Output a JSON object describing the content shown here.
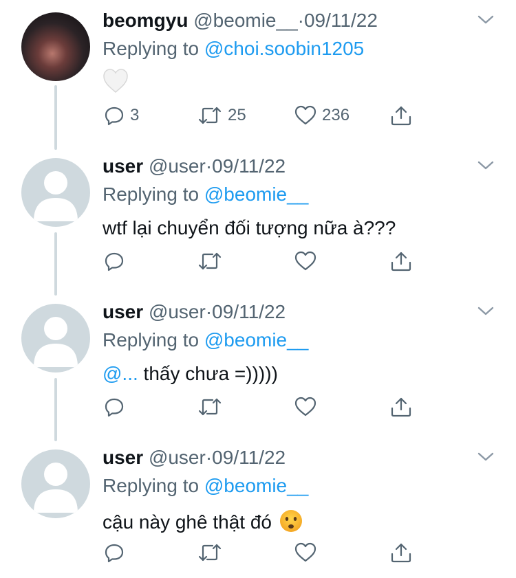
{
  "tweets": [
    {
      "name": "beomgyu",
      "handle": "@beomie__",
      "sep": "·",
      "date": "09/11/22",
      "replying_prefix": "Replying to",
      "replying_to": "@choi.soobin1205",
      "body_emoji": "white-heart",
      "reply_count": "3",
      "retweet_count": "25",
      "like_count": "236"
    },
    {
      "name": "user",
      "handle": "@user",
      "sep": "·",
      "date": "09/11/22",
      "replying_prefix": "Replying to",
      "replying_to": "@beomie__",
      "body": "wtf lại chuyển đối tượng nữa à???"
    },
    {
      "name": "user",
      "handle": "@user",
      "sep": "·",
      "date": "09/11/22",
      "replying_prefix": "Replying to",
      "replying_to": "@beomie__",
      "body_mention": "@...",
      "body": " thấy chưa =)))))"
    },
    {
      "name": "user",
      "handle": "@user",
      "sep": "·",
      "date": "09/11/22",
      "replying_prefix": "Replying to",
      "replying_to": "@beomie__",
      "body": "cậu này ghê thật đó",
      "body_emoji": "frowning-face"
    }
  ],
  "colors": {
    "text": "#0f1419",
    "muted": "#536471",
    "link": "#1d9bf0",
    "thread_line": "#cfd9de"
  }
}
